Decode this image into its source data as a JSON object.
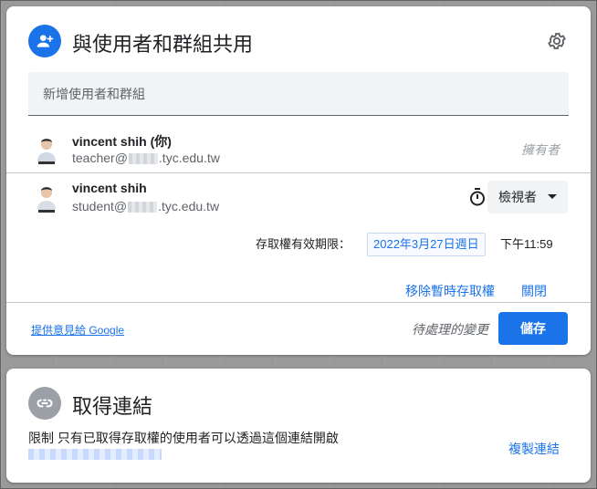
{
  "share_dialog": {
    "title": "與使用者和群組共用",
    "add_placeholder": "新增使用者和群組",
    "owner": {
      "name": "vincent shih (你)",
      "email_prefix": "teacher@",
      "email_suffix": ".tyc.edu.tw",
      "role": "擁有者"
    },
    "member": {
      "name": "vincent shih",
      "email_prefix": "student@",
      "email_suffix": ".tyc.edu.tw",
      "role": "檢視者",
      "expiry_label": "存取權有效期限：",
      "expiry_date": "2022年3月27日週日",
      "expiry_time": "下午11:59",
      "remove_temp_access": "移除暫時存取權",
      "close": "關閉"
    },
    "footer": {
      "feedback": "提供意見給 Google",
      "pending": "待處理的變更",
      "save": "儲存"
    },
    "colors": {
      "accent": "#1a73e8",
      "link_icon_bg": "#9aa0a6"
    }
  },
  "link_dialog": {
    "title": "取得連結",
    "restriction": "限制 只有已取得存取權的使用者可以透過這個連結開啟",
    "copy_link": "複製連結"
  },
  "icons": {
    "share": "person-add-icon",
    "settings": "gear-icon",
    "timer": "timer-icon",
    "dropdown": "caret-down-icon",
    "link": "link-icon"
  }
}
